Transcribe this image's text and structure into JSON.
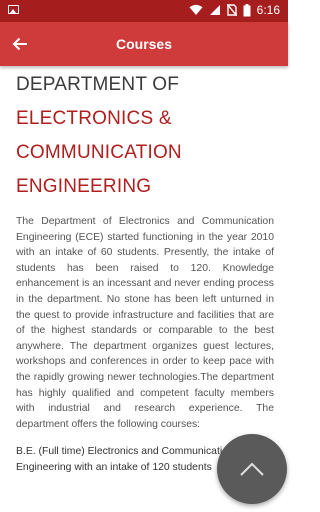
{
  "status_bar": {
    "time": "6:16",
    "left_icon": "image-notification-icon",
    "right_icons": [
      "wifi-icon",
      "signal-icon",
      "no-sim-icon",
      "battery-icon"
    ]
  },
  "app_bar": {
    "title": "Courses",
    "back_icon": "back-arrow-icon",
    "color": "#cf3a3a"
  },
  "department": {
    "title_lines": [
      "DEPARTMENT OF",
      "ELECTRONICS &",
      "COMMUNICATION",
      "ENGINEERING"
    ],
    "description": "The Department of Electronics and Communication Engineering (ECE) started functioning in the year 2010 with an intake of 60 students. Presently, the intake of students has been raised to 120. Knowledge enhancement is an incessant and never ending process in the department. No stone has been left unturned in the quest to provide infrastructure and facilities that are of the highest standards or comparable to the best anywhere. The department organizes guest lectures, workshops and conferences in order to keep pace with the rapidly growing newer technologies.The department has highly qualified and competent faculty members with industrial and research experience. The department offers the following courses:",
    "course": "B.E. (Full time) Electronics and Communication Engineering with an intake of 120 students"
  },
  "fab": {
    "icon": "chevron-up-icon"
  },
  "colors": {
    "status_bar": "#a51d1d",
    "accent_red": "#b01e1e",
    "fab": "#5a5a5a"
  }
}
